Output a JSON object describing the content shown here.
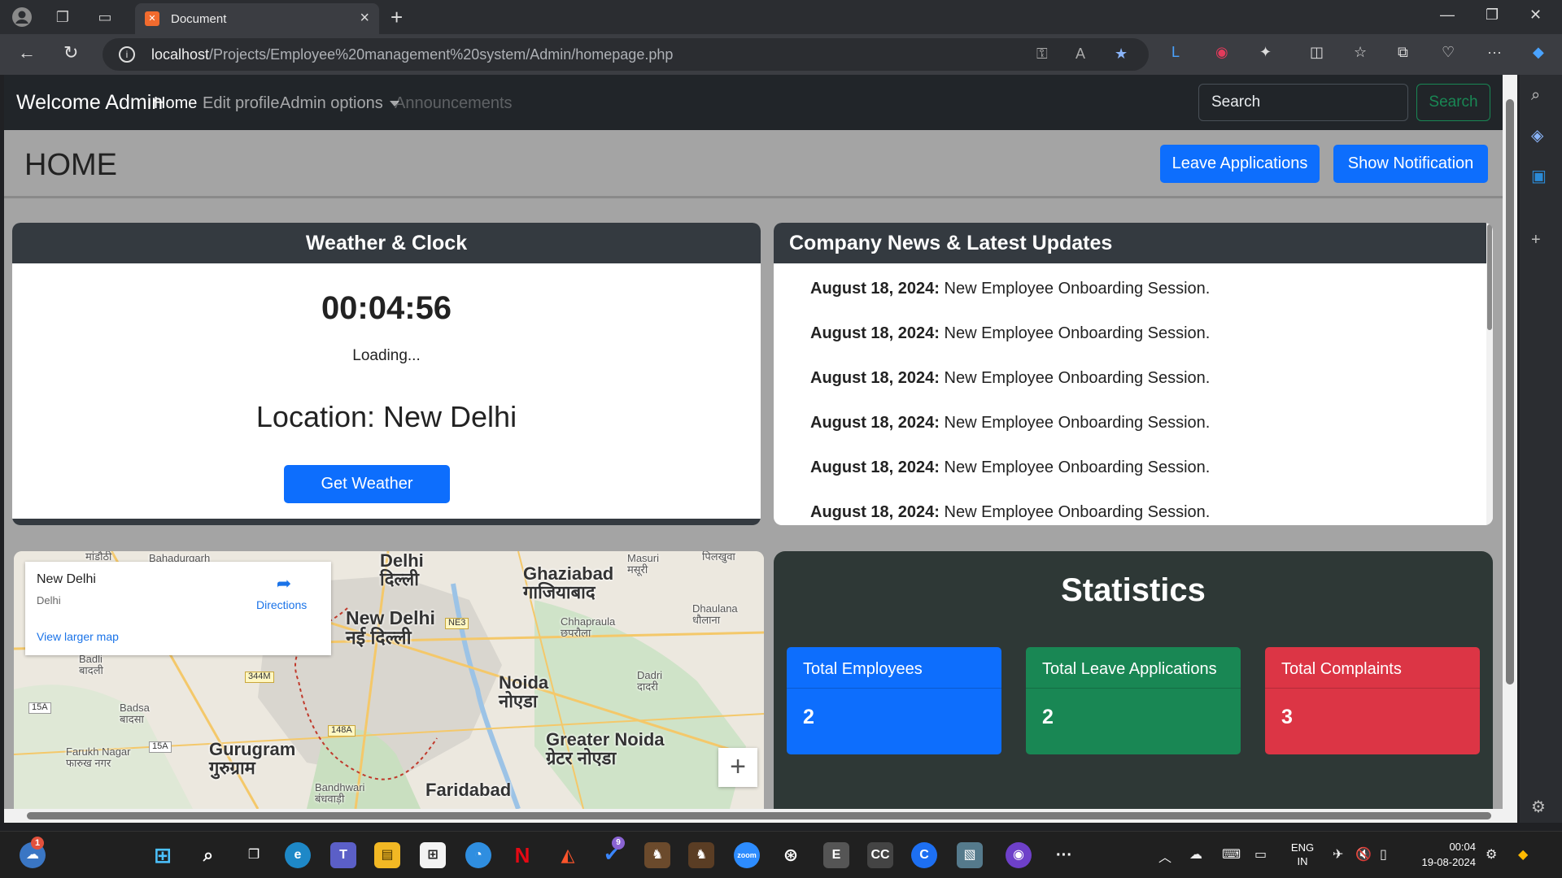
{
  "browser": {
    "tab_title": "Document",
    "url_host": "localhost",
    "url_path": "/Projects/Employee%20management%20system/Admin/homepage.php"
  },
  "navbar": {
    "brand": "Welcome Admin",
    "links": [
      "Home",
      "Edit profile",
      "Admin options",
      "Announcements"
    ],
    "search_placeholder": "Search",
    "search_button": "Search"
  },
  "header": {
    "title": "HOME",
    "leave_button": "Leave Applications",
    "notification_button": "Show Notification"
  },
  "weather": {
    "title": "Weather & Clock",
    "clock": "00:04:56",
    "status": "Loading...",
    "location": "Location: New Delhi",
    "button": "Get Weather"
  },
  "news": {
    "title": "Company News & Latest Updates",
    "items": [
      {
        "date": "August 18, 2024:",
        "text": "New Employee Onboarding Session."
      },
      {
        "date": "August 18, 2024:",
        "text": "New Employee Onboarding Session."
      },
      {
        "date": "August 18, 2024:",
        "text": "New Employee Onboarding Session."
      },
      {
        "date": "August 18, 2024:",
        "text": "New Employee Onboarding Session."
      },
      {
        "date": "August 18, 2024:",
        "text": "New Employee Onboarding Session."
      },
      {
        "date": "August 18, 2024:",
        "text": "New Employee Onboarding Session."
      }
    ]
  },
  "map": {
    "place": "New Delhi",
    "region": "Delhi",
    "directions": "Directions",
    "larger_map": "View larger map",
    "labels": {
      "delhi": "Delhi\nदिल्ली",
      "new_delhi": "New Delhi\nनई दिल्ली",
      "ghaziabad": "Ghaziabad\nगाजियाबाद",
      "noida": "Noida\nनोएडा",
      "greater_noida": "Greater Noida\nग्रेटर नोएडा",
      "gurugram": "Gurugram\nगुरुग्राम",
      "faridabad": "Faridabad",
      "badli": "Badli\nबादली",
      "badsa": "Badsa\nबादसा",
      "farukh_nagar": "Farukh Nagar\nफारुख नगर",
      "bandhwari": "Bandhwari\nबंधवाड़ी",
      "masuri": "Masuri\nमसूरी",
      "pilkhuwa": "पिलखुवा",
      "dhaulana": "Dhaulana\nधौलाना",
      "chhapraula": "Chhapraula\nछपरौला",
      "dadri": "Dadri\nदादरी",
      "mandothi": "मांडौठी",
      "bahadurgarh": "Bahadurgarh",
      "ne3": "NE3",
      "r344m": "344M",
      "r148a": "148A",
      "r15a": "15A",
      "r15a2": "15A"
    }
  },
  "statistics": {
    "title": "Statistics",
    "cards": [
      {
        "label": "Total Employees",
        "value": "2",
        "color": "#0d6efd"
      },
      {
        "label": "Total Leave Applications",
        "value": "2",
        "color": "#198754"
      },
      {
        "label": "Total Complaints",
        "value": "3",
        "color": "#dc3545"
      }
    ]
  },
  "taskbar": {
    "lang": "ENG\nIN",
    "time": "00:04",
    "date": "19-08-2024",
    "weather_badge": "1",
    "todo_badge": "9"
  }
}
